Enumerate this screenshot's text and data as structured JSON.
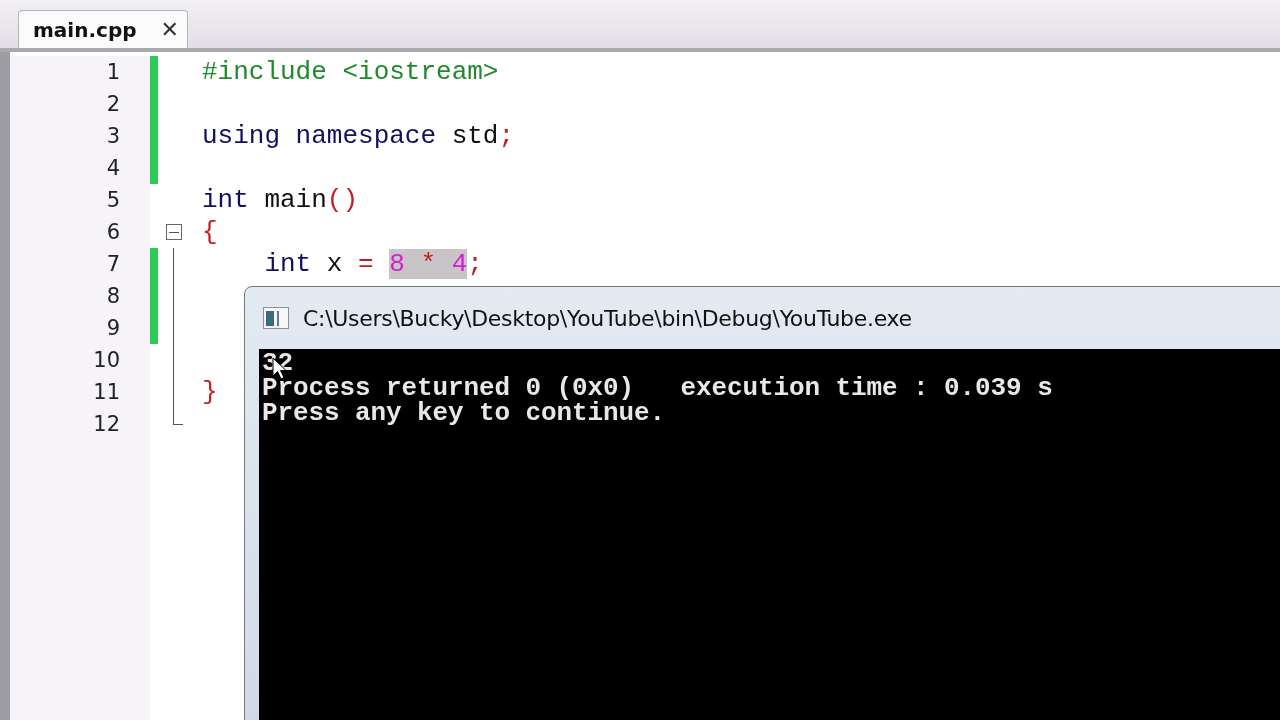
{
  "tabs": [
    {
      "label": "main.cpp",
      "close": "✕",
      "selected": true
    }
  ],
  "editor": {
    "lines": [
      {
        "number": "1",
        "changed": true,
        "collapsible": false,
        "in_block": false,
        "tokens": [
          {
            "text": "#include <iostream>",
            "kind": "preproc"
          }
        ]
      },
      {
        "number": "2",
        "changed": true,
        "collapsible": false,
        "in_block": false
      },
      {
        "number": "3",
        "changed": true,
        "collapsible": false,
        "in_block": false,
        "tokens": [
          {
            "text": "using namespace",
            "kind": "keyword"
          },
          {
            "text": " std",
            "kind": "plain"
          },
          {
            "text": ";",
            "kind": "punct"
          }
        ]
      },
      {
        "number": "4",
        "changed": true,
        "collapsible": false,
        "in_block": false
      },
      {
        "number": "5",
        "changed": false,
        "collapsible": false,
        "in_block": false,
        "tokens": [
          {
            "text": "int",
            "kind": "keyword"
          },
          {
            "text": " main",
            "kind": "plain"
          },
          {
            "text": "()",
            "kind": "punct"
          }
        ]
      },
      {
        "number": "6",
        "changed": false,
        "collapsible": true,
        "in_block": false,
        "tokens": [
          {
            "text": "{",
            "kind": "punct"
          }
        ]
      },
      {
        "number": "7",
        "changed": true,
        "collapsible": false,
        "in_block": true,
        "tokens": [
          {
            "text": "    int",
            "kind": "keyword"
          },
          {
            "text": " x ",
            "kind": "plain"
          },
          {
            "text": "= ",
            "kind": "punct"
          },
          {
            "kind": "selection",
            "tokens": [
              {
                "text": "8",
                "kind": "number"
              },
              {
                "text": " *",
                "kind": "punct"
              },
              {
                "text": " 4",
                "kind": "number"
              }
            ]
          },
          {
            "text": ";",
            "kind": "punct"
          }
        ]
      },
      {
        "number": "8",
        "changed": true,
        "collapsible": false,
        "in_block": true
      },
      {
        "number": "9",
        "changed": true,
        "collapsible": false,
        "in_block": true
      },
      {
        "number": "10",
        "changed": false,
        "collapsible": false,
        "in_block": true
      },
      {
        "number": "11",
        "changed": false,
        "collapsible": false,
        "in_block": true,
        "tokens": [
          {
            "text": "}",
            "kind": "punct"
          }
        ]
      },
      {
        "number": "12",
        "changed": false,
        "collapsible": false,
        "in_block": true
      }
    ]
  },
  "console": {
    "title": "C:\\Users\\Bucky\\Desktop\\YouTube\\bin\\Debug\\YouTube.exe",
    "output": [
      "32",
      "Process returned 0 (0x0)   execution time : 0.039 s",
      "Press any key to continue."
    ]
  }
}
